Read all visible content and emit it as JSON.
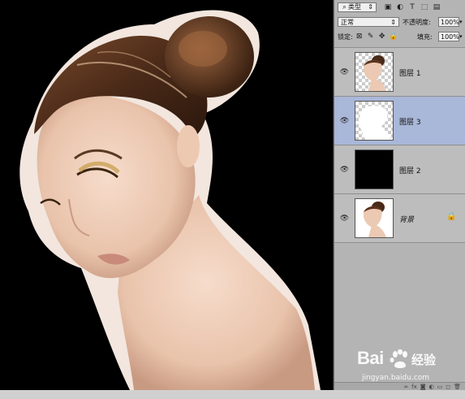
{
  "panel": {
    "filter_kind": "类型",
    "blend_mode": "正常",
    "opacity_label": "不透明度:",
    "opacity_value": "100%",
    "lock_label": "锁定:",
    "fill_label": "填充:",
    "fill_value": "100%"
  },
  "layers": [
    {
      "name": "图层 1",
      "selected": false,
      "thumb": "portrait-transparent",
      "locked": false
    },
    {
      "name": "图层 3",
      "selected": true,
      "thumb": "white-mask",
      "locked": false
    },
    {
      "name": "图层 2",
      "selected": false,
      "thumb": "black-fill",
      "locked": false
    },
    {
      "name": "背景",
      "selected": false,
      "thumb": "portrait",
      "locked": true
    }
  ],
  "watermark": {
    "brand": "Bai",
    "brand_suffix": "经验",
    "url": "jingyan.baidu.com"
  },
  "colors": {
    "panel_bg": "#b4b4b4",
    "selected_layer": "#a9b7d8",
    "canvas_bg": "#000000"
  }
}
